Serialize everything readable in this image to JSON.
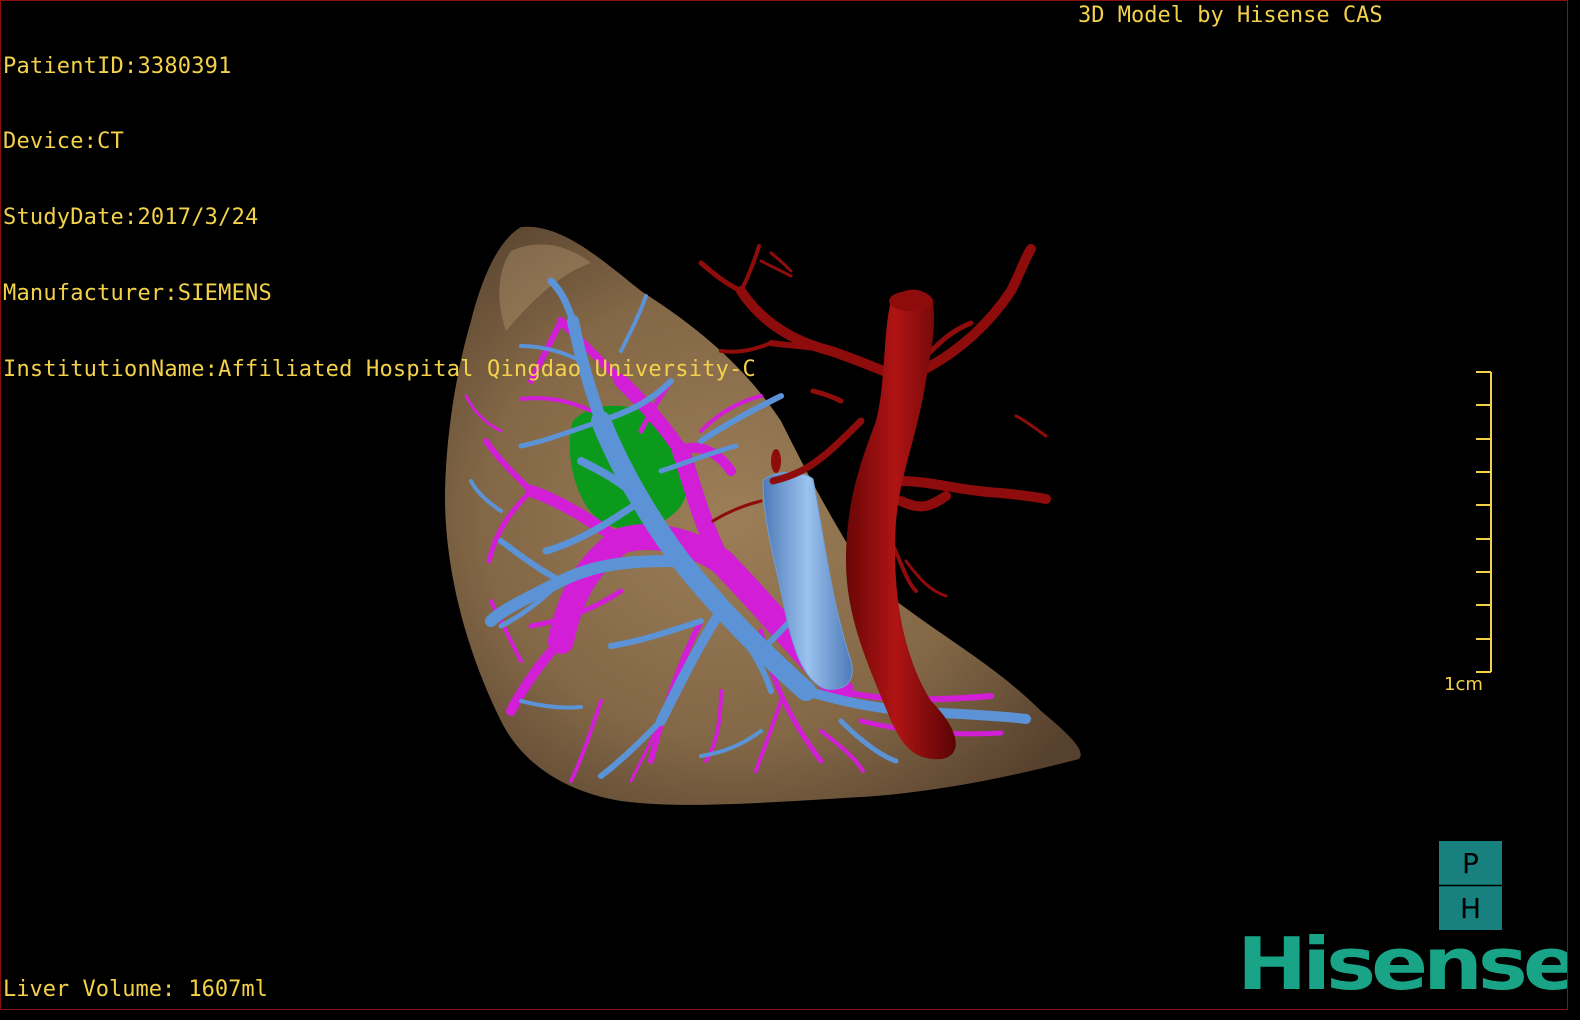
{
  "header": {
    "patient_id": "PatientID:3380391",
    "device": "Device:CT",
    "study_date": "StudyDate:2017/3/24",
    "manufacturer": "Manufacturer:SIEMENS",
    "institution": "InstitutionName:Affiliated Hospital Qingdao University-C"
  },
  "credit": "3D Model by Hisense CAS",
  "footer": {
    "liver_volume": "Liver Volume: 1607ml"
  },
  "scale_bar": {
    "label": "1cm",
    "ticks": 10
  },
  "orientation_cube": {
    "top_letter": "P",
    "bottom_letter": "H",
    "color": "#18807e"
  },
  "logo": {
    "text": "Hisense",
    "color": "#19a488"
  },
  "colors": {
    "overlay_text": "#f3d24a",
    "liver": "#8a6d4a",
    "portal_vein": "#d21ed6",
    "hepatic_vein": "#5b93d6",
    "artery_vena_cava": "#8e0c0c",
    "tumor": "#0c9a1c",
    "viewport_border": "#8a1010"
  },
  "structures": [
    "liver",
    "hepatic-vein",
    "portal-vein",
    "inferior-vena-cava",
    "artery",
    "lesion"
  ]
}
